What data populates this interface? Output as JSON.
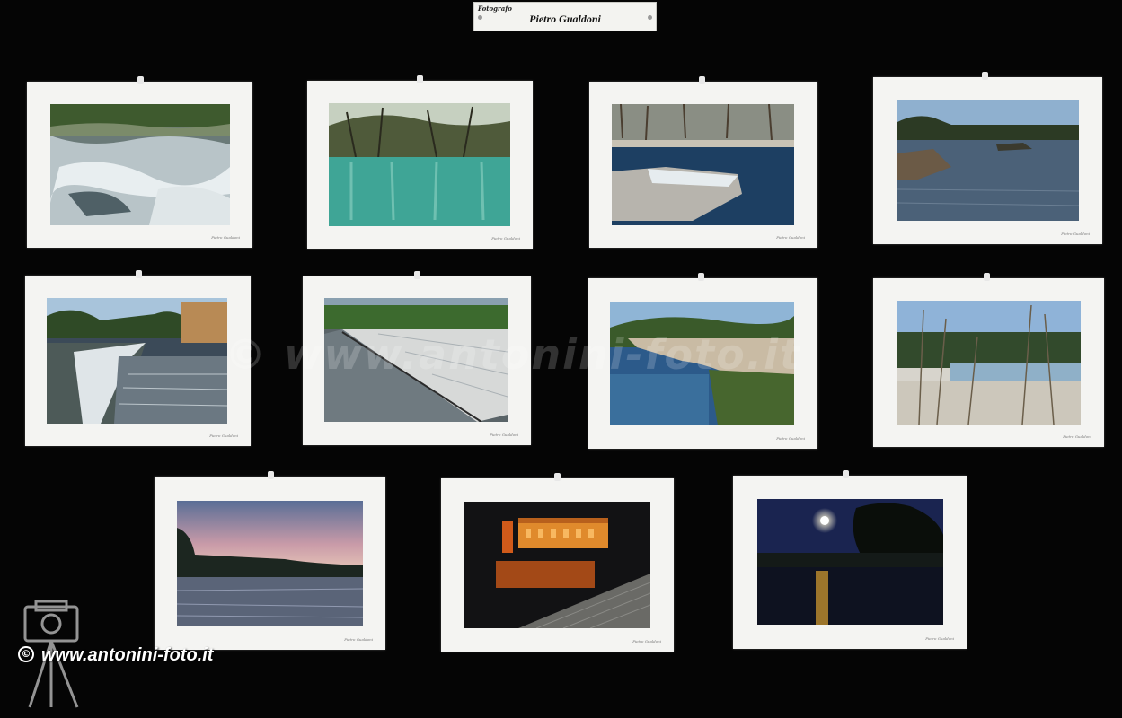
{
  "exhibit": {
    "label_small": "Fotografo",
    "photographer": "Pietro Gualdoni"
  },
  "watermark": {
    "center": "www.antonini-foto.it",
    "bottom": "www.antonini-foto.it",
    "copyright_symbol": "©"
  },
  "photos": [
    {
      "id": "rapids",
      "signature": "Pietro Gualdoni"
    },
    {
      "id": "green-reflection",
      "signature": "Pietro Gualdoni"
    },
    {
      "id": "river-ruins",
      "signature": "Pietro Gualdoni"
    },
    {
      "id": "calm-river",
      "signature": "Pietro Gualdoni"
    },
    {
      "id": "weir-waterfall",
      "signature": "Pietro Gualdoni"
    },
    {
      "id": "dam-spillway",
      "signature": "Pietro Gualdoni"
    },
    {
      "id": "river-cliff",
      "signature": "Pietro Gualdoni"
    },
    {
      "id": "dry-reeds",
      "signature": "Pietro Gualdoni"
    },
    {
      "id": "sunset-river",
      "signature": "Pietro Gualdoni"
    },
    {
      "id": "night-building",
      "signature": "Pietro Gualdoni"
    },
    {
      "id": "moonlight-river",
      "signature": "Pietro Gualdoni"
    }
  ],
  "colors": {
    "wall": "#050505",
    "mat": "#f4f4f2"
  }
}
